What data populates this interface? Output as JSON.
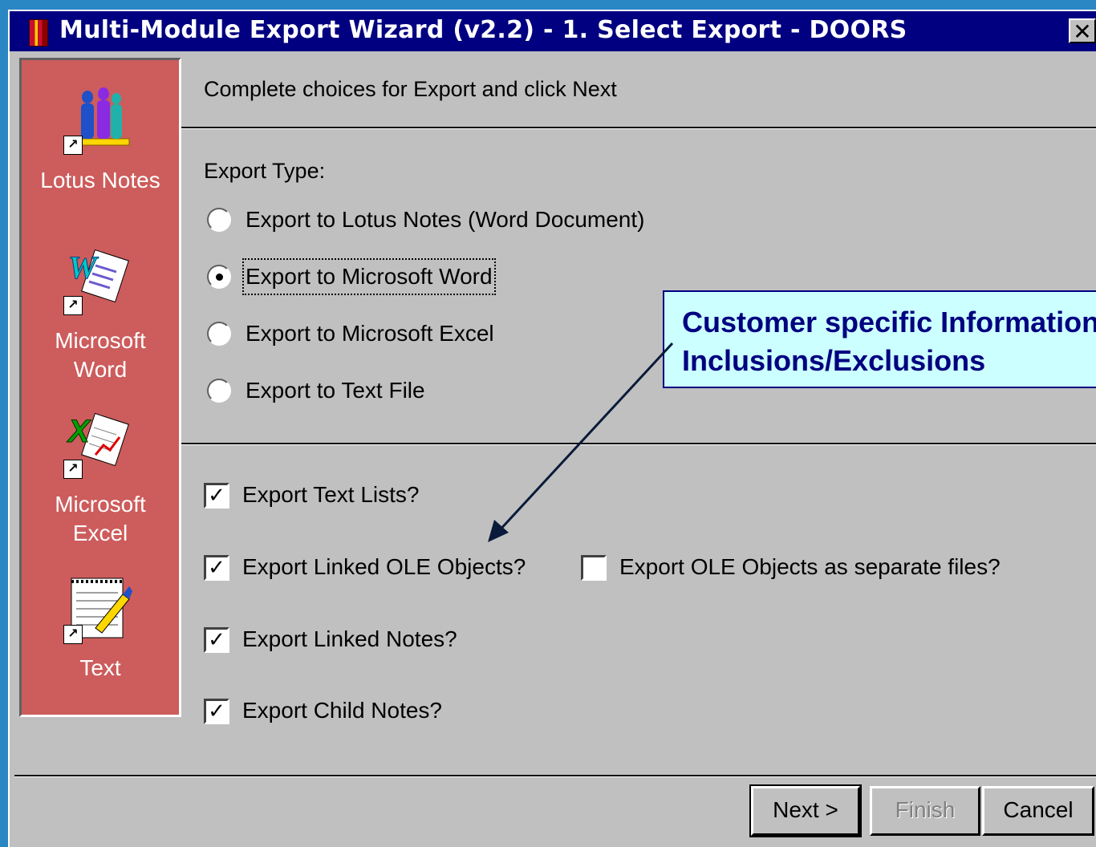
{
  "window": {
    "title": "Multi-Module Export Wizard (v2.2) - 1. Select Export - DOORS",
    "close_glyph": "✕"
  },
  "sidebar": {
    "items": [
      {
        "label_lines": [
          "Lotus Notes"
        ],
        "icon": "lotus-notes-icon"
      },
      {
        "label_lines": [
          "Microsoft",
          "Word"
        ],
        "icon": "microsoft-word-icon"
      },
      {
        "label_lines": [
          "Microsoft",
          "Excel"
        ],
        "icon": "microsoft-excel-icon"
      },
      {
        "label_lines": [
          "Text"
        ],
        "icon": "text-file-icon"
      }
    ]
  },
  "header": {
    "instruction": "Complete choices for Export and click Next"
  },
  "export_type": {
    "label": "Export Type:",
    "selected_index": 1,
    "options": [
      "Export to Lotus Notes (Word Document)",
      "Export to Microsoft Word",
      "Export to Microsoft Excel",
      "Export to Text File"
    ]
  },
  "options": {
    "text_lists": {
      "label": "Export Text Lists?",
      "checked": true
    },
    "linked_ole": {
      "label": "Export Linked OLE Objects?",
      "checked": true
    },
    "ole_separate": {
      "label": "Export OLE Objects as separate files?",
      "checked": false
    },
    "linked_notes": {
      "label": "Export Linked Notes?",
      "checked": true
    },
    "child_notes": {
      "label": "Export Child Notes?",
      "checked": true
    }
  },
  "callout": {
    "line1": "Customer specific Information",
    "line2": "Inclusions/Exclusions"
  },
  "buttons": {
    "next": "Next >",
    "finish": "Finish",
    "cancel": "Cancel",
    "finish_enabled": false
  },
  "colors": {
    "titlebar": "#000080",
    "sidebar": "#cd5c5c",
    "callout_bg": "#ccffff",
    "callout_text": "#000080"
  }
}
